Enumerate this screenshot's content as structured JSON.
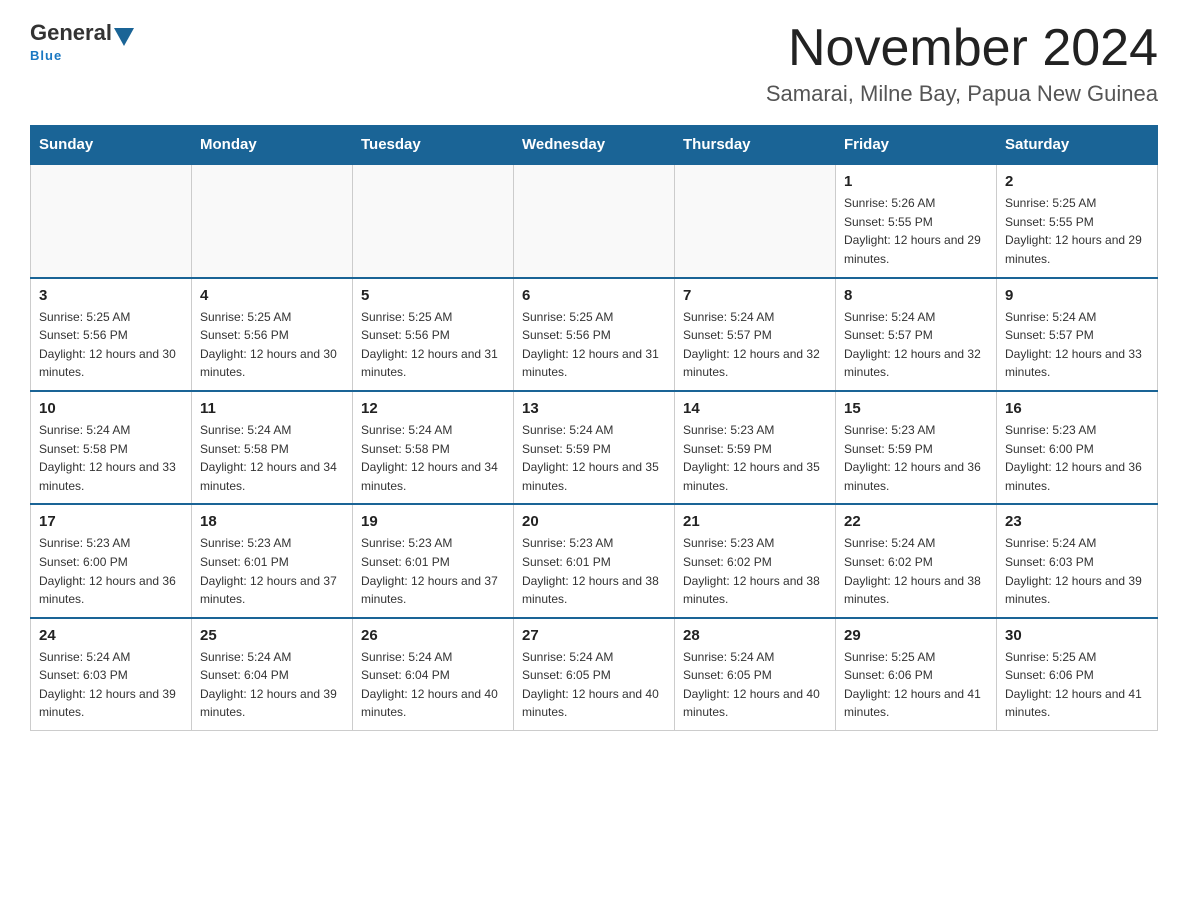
{
  "header": {
    "logo_general": "General",
    "logo_blue": "Blue",
    "month_title": "November 2024",
    "location": "Samarai, Milne Bay, Papua New Guinea"
  },
  "weekdays": [
    "Sunday",
    "Monday",
    "Tuesday",
    "Wednesday",
    "Thursday",
    "Friday",
    "Saturday"
  ],
  "weeks": [
    [
      {
        "day": "",
        "info": ""
      },
      {
        "day": "",
        "info": ""
      },
      {
        "day": "",
        "info": ""
      },
      {
        "day": "",
        "info": ""
      },
      {
        "day": "",
        "info": ""
      },
      {
        "day": "1",
        "info": "Sunrise: 5:26 AM\nSunset: 5:55 PM\nDaylight: 12 hours and 29 minutes."
      },
      {
        "day": "2",
        "info": "Sunrise: 5:25 AM\nSunset: 5:55 PM\nDaylight: 12 hours and 29 minutes."
      }
    ],
    [
      {
        "day": "3",
        "info": "Sunrise: 5:25 AM\nSunset: 5:56 PM\nDaylight: 12 hours and 30 minutes."
      },
      {
        "day": "4",
        "info": "Sunrise: 5:25 AM\nSunset: 5:56 PM\nDaylight: 12 hours and 30 minutes."
      },
      {
        "day": "5",
        "info": "Sunrise: 5:25 AM\nSunset: 5:56 PM\nDaylight: 12 hours and 31 minutes."
      },
      {
        "day": "6",
        "info": "Sunrise: 5:25 AM\nSunset: 5:56 PM\nDaylight: 12 hours and 31 minutes."
      },
      {
        "day": "7",
        "info": "Sunrise: 5:24 AM\nSunset: 5:57 PM\nDaylight: 12 hours and 32 minutes."
      },
      {
        "day": "8",
        "info": "Sunrise: 5:24 AM\nSunset: 5:57 PM\nDaylight: 12 hours and 32 minutes."
      },
      {
        "day": "9",
        "info": "Sunrise: 5:24 AM\nSunset: 5:57 PM\nDaylight: 12 hours and 33 minutes."
      }
    ],
    [
      {
        "day": "10",
        "info": "Sunrise: 5:24 AM\nSunset: 5:58 PM\nDaylight: 12 hours and 33 minutes."
      },
      {
        "day": "11",
        "info": "Sunrise: 5:24 AM\nSunset: 5:58 PM\nDaylight: 12 hours and 34 minutes."
      },
      {
        "day": "12",
        "info": "Sunrise: 5:24 AM\nSunset: 5:58 PM\nDaylight: 12 hours and 34 minutes."
      },
      {
        "day": "13",
        "info": "Sunrise: 5:24 AM\nSunset: 5:59 PM\nDaylight: 12 hours and 35 minutes."
      },
      {
        "day": "14",
        "info": "Sunrise: 5:23 AM\nSunset: 5:59 PM\nDaylight: 12 hours and 35 minutes."
      },
      {
        "day": "15",
        "info": "Sunrise: 5:23 AM\nSunset: 5:59 PM\nDaylight: 12 hours and 36 minutes."
      },
      {
        "day": "16",
        "info": "Sunrise: 5:23 AM\nSunset: 6:00 PM\nDaylight: 12 hours and 36 minutes."
      }
    ],
    [
      {
        "day": "17",
        "info": "Sunrise: 5:23 AM\nSunset: 6:00 PM\nDaylight: 12 hours and 36 minutes."
      },
      {
        "day": "18",
        "info": "Sunrise: 5:23 AM\nSunset: 6:01 PM\nDaylight: 12 hours and 37 minutes."
      },
      {
        "day": "19",
        "info": "Sunrise: 5:23 AM\nSunset: 6:01 PM\nDaylight: 12 hours and 37 minutes."
      },
      {
        "day": "20",
        "info": "Sunrise: 5:23 AM\nSunset: 6:01 PM\nDaylight: 12 hours and 38 minutes."
      },
      {
        "day": "21",
        "info": "Sunrise: 5:23 AM\nSunset: 6:02 PM\nDaylight: 12 hours and 38 minutes."
      },
      {
        "day": "22",
        "info": "Sunrise: 5:24 AM\nSunset: 6:02 PM\nDaylight: 12 hours and 38 minutes."
      },
      {
        "day": "23",
        "info": "Sunrise: 5:24 AM\nSunset: 6:03 PM\nDaylight: 12 hours and 39 minutes."
      }
    ],
    [
      {
        "day": "24",
        "info": "Sunrise: 5:24 AM\nSunset: 6:03 PM\nDaylight: 12 hours and 39 minutes."
      },
      {
        "day": "25",
        "info": "Sunrise: 5:24 AM\nSunset: 6:04 PM\nDaylight: 12 hours and 39 minutes."
      },
      {
        "day": "26",
        "info": "Sunrise: 5:24 AM\nSunset: 6:04 PM\nDaylight: 12 hours and 40 minutes."
      },
      {
        "day": "27",
        "info": "Sunrise: 5:24 AM\nSunset: 6:05 PM\nDaylight: 12 hours and 40 minutes."
      },
      {
        "day": "28",
        "info": "Sunrise: 5:24 AM\nSunset: 6:05 PM\nDaylight: 12 hours and 40 minutes."
      },
      {
        "day": "29",
        "info": "Sunrise: 5:25 AM\nSunset: 6:06 PM\nDaylight: 12 hours and 41 minutes."
      },
      {
        "day": "30",
        "info": "Sunrise: 5:25 AM\nSunset: 6:06 PM\nDaylight: 12 hours and 41 minutes."
      }
    ]
  ]
}
